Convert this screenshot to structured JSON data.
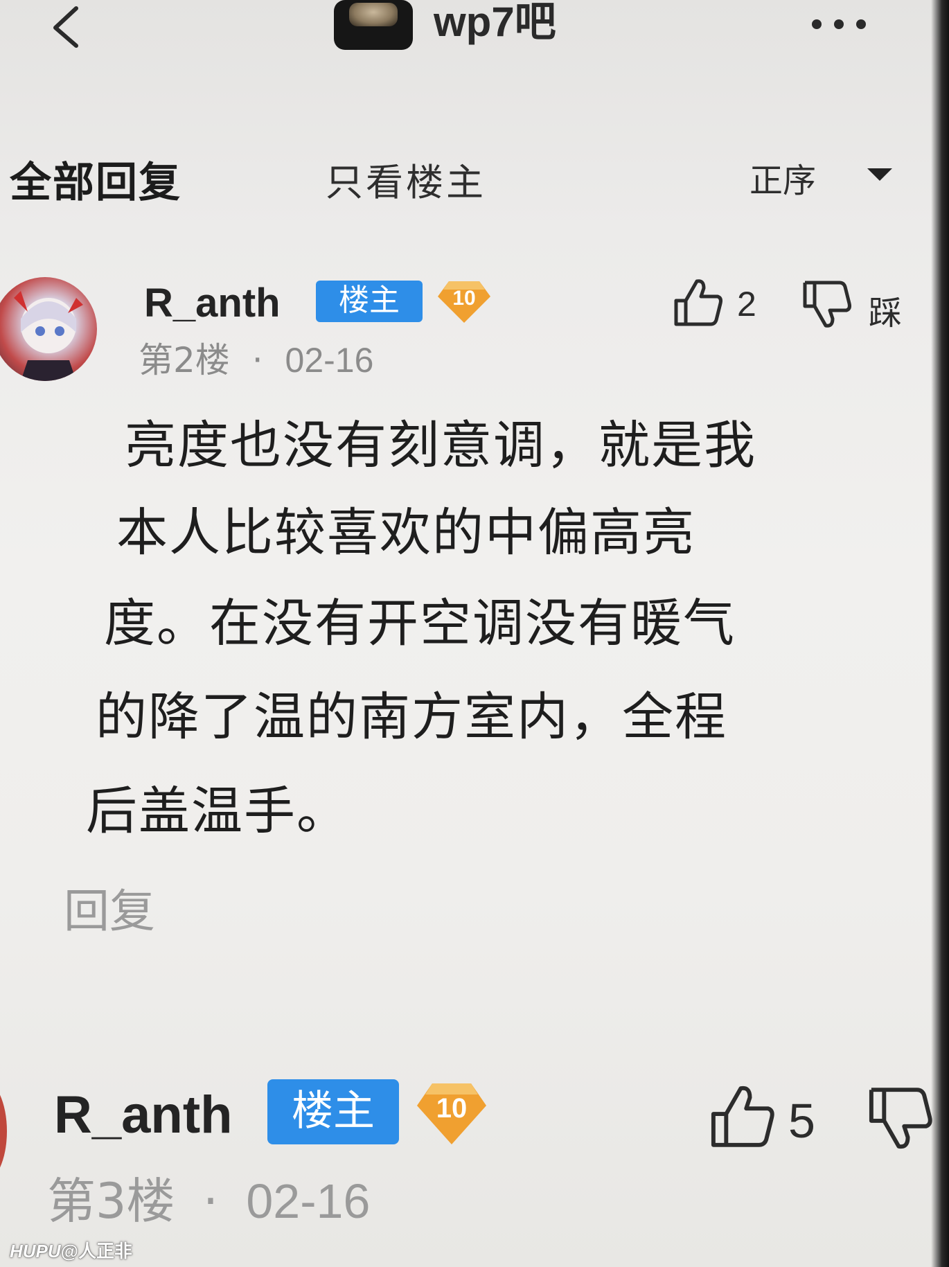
{
  "navbar": {
    "title": "wp7吧",
    "back_icon": "chevron-left-icon",
    "more_icon": "more-dots-icon"
  },
  "filters": {
    "all_replies": "全部回复",
    "only_op": "只看楼主",
    "sort_label": "正序"
  },
  "posts": [
    {
      "username": "R_anth",
      "op_badge": "楼主",
      "level": "10",
      "floor": "第2楼",
      "separator": "·",
      "date": "02-16",
      "likes": "2",
      "dislike_label": "踩",
      "content_lines": [
        "亮度也没有刻意调，就是我",
        "本人比较喜欢的中偏高亮",
        "度。在没有开空调没有暖气",
        "的降了温的南方室内，全程",
        "后盖温手。"
      ],
      "reply_label": "回复"
    },
    {
      "username": "R_anth",
      "op_badge": "楼主",
      "level": "10",
      "floor": "第3楼",
      "separator": "·",
      "date": "02-16",
      "likes": "5"
    }
  ],
  "watermark": {
    "brand": "HUPU",
    "handle": "@人正非"
  },
  "colors": {
    "op_badge_bg": "#2e8ee8",
    "level_badge": "#f0a030",
    "meta_text": "#8b8b8b",
    "background": "#eceae7"
  }
}
